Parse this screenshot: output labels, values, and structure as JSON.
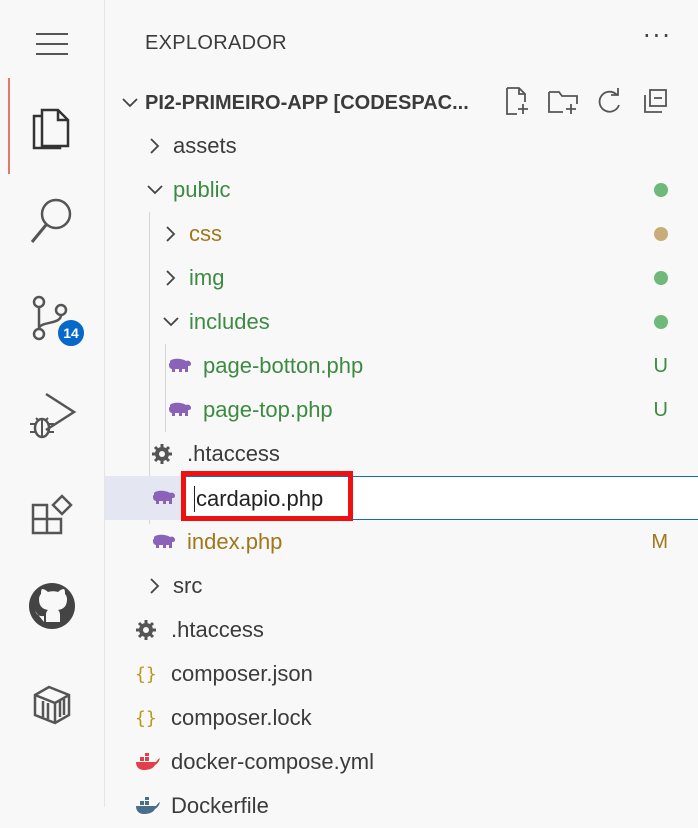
{
  "activity_bar": {
    "items": [
      {
        "name": "menu",
        "icon": "hamburger-menu-icon"
      },
      {
        "name": "explorer",
        "icon": "files-icon",
        "active": true
      },
      {
        "name": "search",
        "icon": "search-icon"
      },
      {
        "name": "source-control",
        "icon": "source-control-icon",
        "badge": "14"
      },
      {
        "name": "run-debug",
        "icon": "run-debug-icon"
      },
      {
        "name": "extensions",
        "icon": "extensions-icon"
      },
      {
        "name": "github",
        "icon": "github-icon"
      },
      {
        "name": "remote-explorer",
        "icon": "remote-explorer-icon"
      }
    ]
  },
  "sidebar": {
    "title": "EXPLORADOR",
    "more": "···",
    "section_title": "PI2-PRIMEIRO-APP [CODESPAC...",
    "section_actions": [
      "new-file-icon",
      "new-folder-icon",
      "refresh-icon",
      "collapse-all-icon"
    ]
  },
  "tree": [
    {
      "label": "assets",
      "type": "folder",
      "expanded": false,
      "status": ""
    },
    {
      "label": "public",
      "type": "folder",
      "expanded": true,
      "status": "dot-green"
    },
    {
      "label": "css",
      "type": "folder",
      "expanded": false,
      "status": "dot-brown"
    },
    {
      "label": "img",
      "type": "folder",
      "expanded": false,
      "status": "dot-green"
    },
    {
      "label": "includes",
      "type": "folder",
      "expanded": true,
      "status": "dot-green"
    },
    {
      "label": "page-botton.php",
      "type": "php",
      "status": "U"
    },
    {
      "label": "page-top.php",
      "type": "php",
      "status": "U"
    },
    {
      "label": ".htaccess",
      "type": "config",
      "status": ""
    },
    {
      "label": "cardapio.php",
      "type": "php",
      "status": "",
      "renaming": true
    },
    {
      "label": "index.php",
      "type": "php",
      "status": "M"
    },
    {
      "label": "src",
      "type": "folder",
      "expanded": false,
      "status": ""
    },
    {
      "label": ".htaccess",
      "type": "config",
      "status": ""
    },
    {
      "label": "composer.json",
      "type": "json",
      "status": ""
    },
    {
      "label": "composer.lock",
      "type": "json",
      "status": ""
    },
    {
      "label": "docker-compose.yml",
      "type": "docker",
      "status": ""
    },
    {
      "label": "Dockerfile",
      "type": "docker",
      "status": ""
    }
  ],
  "colors": {
    "accent": "#0f6bd1",
    "untracked_green": "#3d8b43",
    "modified_brown": "#a0771b",
    "highlight_red": "#ee1111",
    "php_purple": "#8a63b8",
    "docker_red": "#e0404a"
  }
}
